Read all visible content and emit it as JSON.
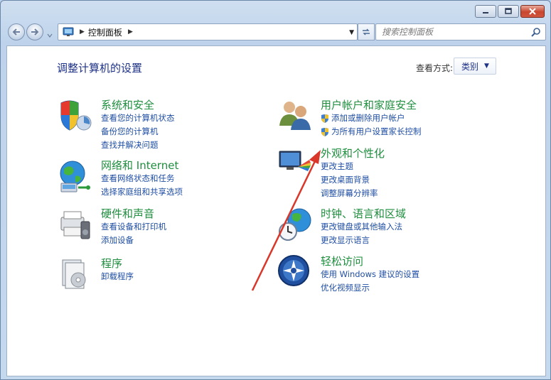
{
  "window": {
    "caption_buttons": [
      "minimize-icon",
      "maximize-icon",
      "close-icon"
    ]
  },
  "navigation": {
    "breadcrumb": "控制面板",
    "search_placeholder": "搜索控制面板"
  },
  "main": {
    "title": "调整计算机的设置",
    "view_by_label": "查看方式:",
    "view_by_value": "类别"
  },
  "left_categories": [
    {
      "title": "系统和安全",
      "icon": "system-security-icon",
      "links": [
        "查看您的计算机状态",
        "备份您的计算机",
        "查找并解决问题"
      ]
    },
    {
      "title": "网络和 Internet",
      "icon": "network-icon",
      "links": [
        "查看网络状态和任务",
        "选择家庭组和共享选项"
      ]
    },
    {
      "title": "硬件和声音",
      "icon": "hardware-sound-icon",
      "links": [
        "查看设备和打印机",
        "添加设备"
      ]
    },
    {
      "title": "程序",
      "icon": "programs-icon",
      "links": [
        "卸载程序"
      ]
    }
  ],
  "right_categories": [
    {
      "title": "用户帐户和家庭安全",
      "icon": "user-accounts-icon",
      "links": [
        "添加或删除用户帐户",
        "为所有用户设置家长控制"
      ]
    },
    {
      "title": "外观和个性化",
      "icon": "appearance-icon",
      "links": [
        "更改主题",
        "更改桌面背景",
        "调整屏幕分辨率"
      ]
    },
    {
      "title": "时钟、语言和区域",
      "icon": "clock-language-icon",
      "links": [
        "更改键盘或其他输入法",
        "更改显示语言"
      ]
    },
    {
      "title": "轻松访问",
      "icon": "ease-of-access-icon",
      "links": [
        "使用 Windows 建议的设置",
        "优化视频显示"
      ]
    }
  ],
  "colors": {
    "title_green": "#1e8e3e",
    "link_blue": "#1f4ea3",
    "annotation_arrow": "#d9372a"
  }
}
